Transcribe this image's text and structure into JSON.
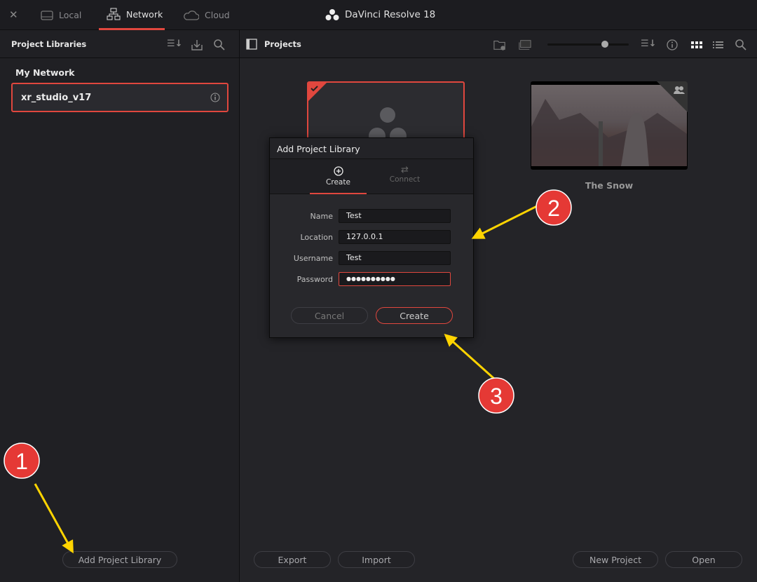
{
  "topbar": {
    "close_icon": "close-icon",
    "tabs": [
      {
        "label": "Local",
        "icon": "drive-icon"
      },
      {
        "label": "Network",
        "icon": "network-icon",
        "active": true
      },
      {
        "label": "Cloud",
        "icon": "cloud-icon"
      }
    ],
    "app_title": "DaVinci Resolve 18"
  },
  "left_panel": {
    "title": "Project Libraries",
    "group": "My Network",
    "libraries": [
      {
        "name": "xr_studio_v17",
        "selected": true
      }
    ],
    "add_button": "Add Project Library"
  },
  "projects_panel": {
    "title": "Projects",
    "thumbnail_slider_value": 0.71,
    "projects": [
      {
        "name": "",
        "selected": true
      },
      {
        "name": "The Snow",
        "shared": true
      }
    ],
    "buttons": {
      "export": "Export",
      "import": "Import",
      "new_project": "New Project",
      "open": "Open"
    }
  },
  "dialog": {
    "title": "Add Project Library",
    "tabs": [
      {
        "label": "Create",
        "active": true
      },
      {
        "label": "Connect"
      }
    ],
    "fields": [
      {
        "label": "Name",
        "value": "Test"
      },
      {
        "label": "Location",
        "value": "127.0.0.1"
      },
      {
        "label": "Username",
        "value": "Test"
      },
      {
        "label": "Password",
        "value": "●●●●●●●●●●"
      }
    ],
    "cancel": "Cancel",
    "create": "Create"
  },
  "annotations": [
    {
      "number": "1"
    },
    {
      "number": "2"
    },
    {
      "number": "3"
    }
  ],
  "colors": {
    "accent": "#e0473e",
    "annotation_circle": "#e53935",
    "arrow": "#ffd400"
  }
}
